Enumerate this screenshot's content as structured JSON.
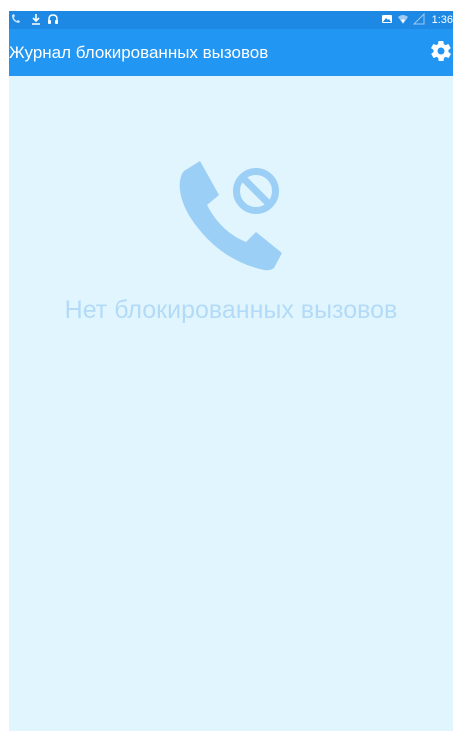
{
  "status_bar": {
    "time": "1:36",
    "left_icons": [
      "missed-call-icon",
      "download-icon",
      "headset-icon"
    ],
    "right_icons": [
      "photo-icon",
      "wifi-icon",
      "signal-icon"
    ]
  },
  "app_bar": {
    "title": "Журнал блокированных вызовов",
    "settings_icon": "gear-icon"
  },
  "empty_state": {
    "icon": "blocked-call-icon",
    "message": "Нет блокированных вызовов"
  },
  "colors": {
    "status_bar": "#1e88e5",
    "app_bar": "#2196f3",
    "background": "#e1f5fe",
    "empty_icon": "#9ccff5",
    "empty_text": "#b3dbf7"
  }
}
